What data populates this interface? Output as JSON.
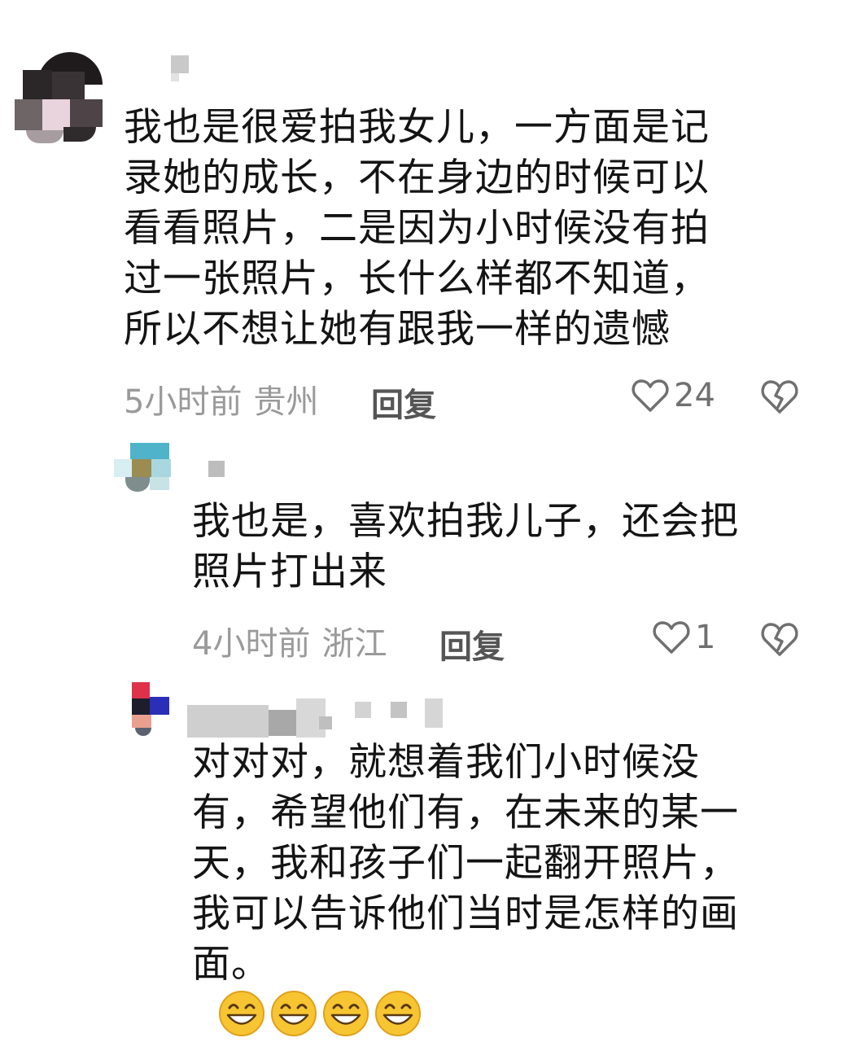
{
  "comments": [
    {
      "text": "我也是很爱拍我女儿，一方面是记\n录她的成长，不在身边的时候可以\n看看照片，二是因为小时候没有拍\n过一张照片，长什么样都不知道，\n所以不想让她有跟我一样的遗憾",
      "time": "5小时前",
      "location": "贵州",
      "reply_label": "回复",
      "likes": "24"
    },
    {
      "text": "我也是，喜欢拍我儿子，还会把\n照片打出来",
      "time": "4小时前",
      "location": "浙江",
      "reply_label": "回复",
      "likes": "1"
    },
    {
      "text": "对对对，就想着我们小时候没\n有，希望他们有，在未来的某一\n天，我和孩子们一起翻开照片，\n我可以告诉他们当时是怎样的画\n面。",
      "emoji_names": [
        "grinning-face-icon",
        "grinning-face-icon",
        "grinning-face-icon",
        "grinning-face-icon"
      ]
    }
  ],
  "colors": {
    "text": "#141414",
    "meta": "#9a9a9a",
    "reply": "#555555",
    "icon": "#707070",
    "emoji_face": "#f7c531"
  }
}
